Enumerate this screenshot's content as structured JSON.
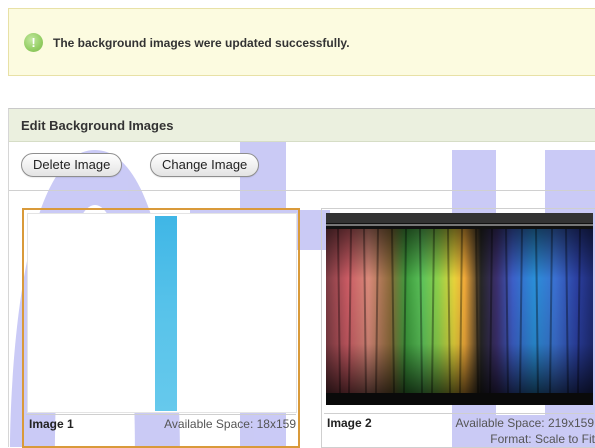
{
  "notice": {
    "icon": "info-icon",
    "icon_glyph": "!",
    "message": "The background images were updated successfully."
  },
  "panel": {
    "title": "Edit Background Images",
    "toolbar": {
      "delete_label": "Delete Image",
      "change_label": "Change Image"
    },
    "images": [
      {
        "name": "Image 1",
        "available_space": "Available Space: 18x159",
        "selected": true
      },
      {
        "name": "Image 2",
        "available_space": "Available Space: 219x159",
        "format": "Format: Scale to Fit"
      }
    ]
  },
  "colors": {
    "notice_bg": "#fcfbe0",
    "panel_header_bg": "#ebf0df",
    "selection_border": "#d99a3a",
    "watermark": "#a7a7f0"
  }
}
